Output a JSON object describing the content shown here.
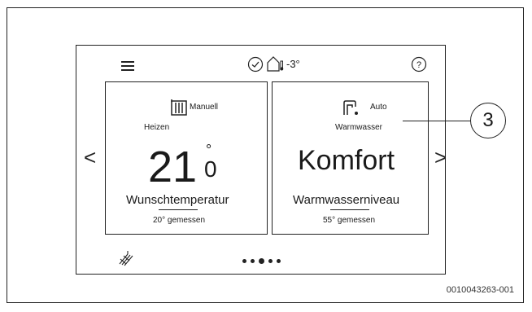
{
  "top_bar": {
    "menu_icon": "menu-icon",
    "status_icon": "check-circle-icon",
    "outdoor_icon": "house-thermometer-icon",
    "outdoor_temp": "-3°",
    "help_label": "?"
  },
  "heating_tile": {
    "icon": "radiator-icon",
    "mode": "Manuell",
    "title": "Heizen",
    "setpoint_main": "21",
    "setpoint_degree": "°",
    "setpoint_decimal": "0",
    "setpoint_label": "Wunschtemperatur",
    "measured": "20° gemessen"
  },
  "water_tile": {
    "icon": "water-tap-icon",
    "mode": "Auto",
    "title": "Warmwasser",
    "level_value": "Komfort",
    "level_label": "Warmwasserniveau",
    "measured": "55° gemessen"
  },
  "navigation": {
    "prev": "<",
    "next": ">",
    "page_count": 5,
    "active_page": 3
  },
  "footer_icon": "solar-panel-icon",
  "callout": {
    "number": "3"
  },
  "reference_code": "0010043263-001"
}
